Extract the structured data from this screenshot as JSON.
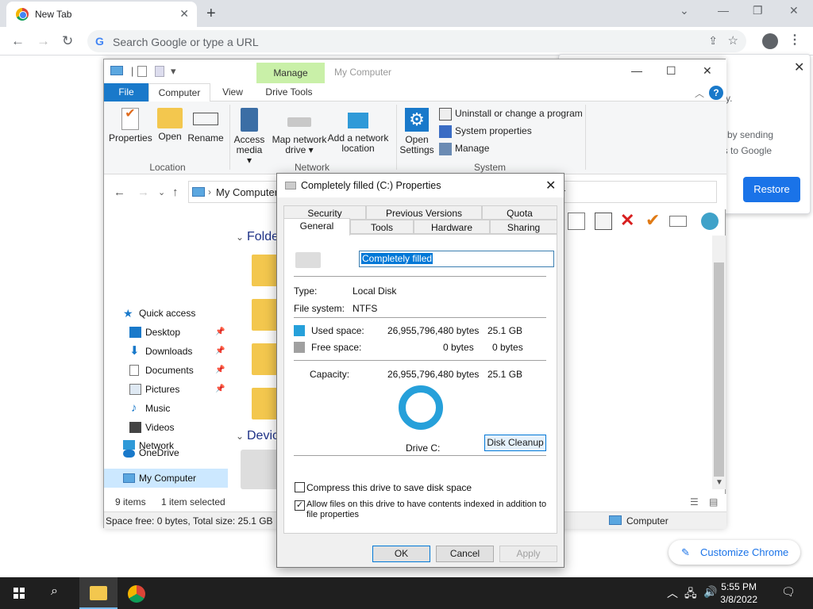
{
  "browser": {
    "tab_title": "New Tab",
    "omnibox_placeholder": "Search Google or type a URL",
    "restore_popup": {
      "fragment1": "y.",
      "fragment2": "er by sending",
      "fragment3": "ics to Google",
      "restore_label": "Restore"
    },
    "customize_label": "Customize Chrome"
  },
  "explorer": {
    "manage_tab": "Manage",
    "window_title": "My Computer",
    "ribbon_tabs": [
      "File",
      "Computer",
      "View",
      "Drive Tools"
    ],
    "ribbon": {
      "location_buttons": [
        "Properties",
        "Open",
        "Rename"
      ],
      "network_buttons": [
        {
          "l1": "Access",
          "l2": "media ▾"
        },
        {
          "l1": "Map network",
          "l2": "drive ▾"
        },
        {
          "l1": "Add a network",
          "l2": "location"
        }
      ],
      "system_open": {
        "l1": "Open",
        "l2": "Settings"
      },
      "system_items": [
        "Uninstall or change a program",
        "System properties",
        "Manage"
      ],
      "groups": [
        "Location",
        "Network",
        "System"
      ]
    },
    "address": "My Computer",
    "address_tail": "r",
    "nav": {
      "quick_access": "Quick access",
      "items": [
        "Desktop",
        "Downloads",
        "Documents",
        "Pictures",
        "Music",
        "Videos"
      ],
      "onedrive": "OneDrive",
      "mycomputer": "My Computer",
      "network": "Network"
    },
    "sections": {
      "folders": "Folde",
      "devices": "Devic"
    },
    "status": {
      "items": "9 items",
      "selected": "1 item selected"
    },
    "bottom": {
      "space": "Space free: 0 bytes, Total size: 25.1 GB",
      "location": "Computer"
    }
  },
  "dialog": {
    "title": "Completely filled (C:) Properties",
    "tabs_top": [
      "Security",
      "Previous Versions",
      "Quota"
    ],
    "tabs_bottom": [
      "General",
      "Tools",
      "Hardware",
      "Sharing"
    ],
    "drive_name": "Completely filled",
    "type_label": "Type:",
    "type_value": "Local Disk",
    "fs_label": "File system:",
    "fs_value": "NTFS",
    "used_label": "Used space:",
    "used_bytes": "26,955,796,480 bytes",
    "used_gb": "25.1 GB",
    "free_label": "Free space:",
    "free_bytes": "0 bytes",
    "free_gb": "0 bytes",
    "cap_label": "Capacity:",
    "cap_bytes": "26,955,796,480 bytes",
    "cap_gb": "25.1 GB",
    "drive_label": "Drive C:",
    "cleanup_label": "Disk Cleanup",
    "compress_label": "Compress this drive to save disk space",
    "index_label_1": "Allow files on this drive to have contents indexed in addition to",
    "index_label_2": "file properties",
    "compress_checked": false,
    "index_checked": true,
    "ok": "OK",
    "cancel": "Cancel",
    "apply": "Apply",
    "colors": {
      "used": "#26a0da",
      "free": "#a0a0a0"
    }
  },
  "taskbar": {
    "time": "5:55 PM",
    "date": "3/8/2022"
  }
}
